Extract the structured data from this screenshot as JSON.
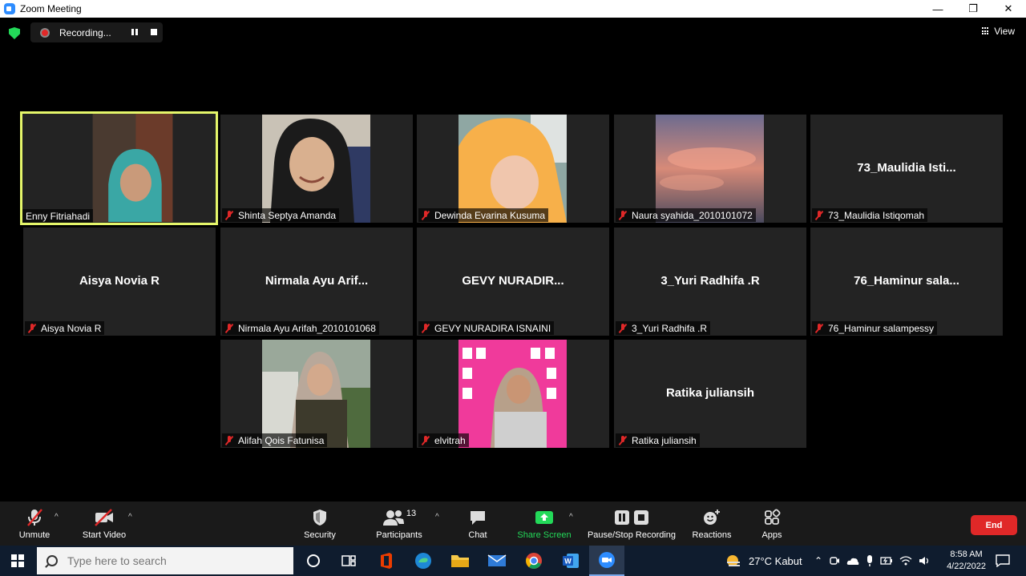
{
  "window": {
    "title": "Zoom Meeting",
    "controls": [
      "—",
      "❐",
      "✕"
    ]
  },
  "meeting": {
    "recording_label": "Recording...",
    "view_label": "View",
    "tiles": [
      {
        "label": "Enny Fitriahadi",
        "big_name": "",
        "active": true,
        "muted": false,
        "video": true
      },
      {
        "label": "Shinta Septya Amanda",
        "big_name": "",
        "muted": true,
        "video": true
      },
      {
        "label": "Dewinda Evarina Kusuma",
        "big_name": "",
        "muted": true,
        "video": true
      },
      {
        "label": "Naura syahida_2010101072",
        "big_name": "",
        "muted": true,
        "video": true
      },
      {
        "label": "73_Maulidia Istiqomah",
        "big_name": "73_Maulidia  Isti...",
        "muted": true,
        "video": false
      },
      {
        "label": "Aisya Novia R",
        "big_name": "Aisya Novia R",
        "muted": true,
        "video": false
      },
      {
        "label": "Nirmala Ayu Arifah_2010101068",
        "big_name": "Nirmala  Ayu  Arif...",
        "muted": true,
        "video": false
      },
      {
        "label": "GEVY NURADIRA ISNAINI",
        "big_name": "GEVY  NURADIR...",
        "muted": true,
        "video": false
      },
      {
        "label": "3_Yuri Radhifa .R",
        "big_name": "3_Yuri Radhifa .R",
        "muted": true,
        "video": false
      },
      {
        "label": "76_Haminur salampessy",
        "big_name": "76_Haminur  sala...",
        "muted": true,
        "video": false
      },
      {
        "label": "Alifah Qois Fatunisa",
        "big_name": "",
        "muted": true,
        "video": true
      },
      {
        "label": "elvitrah",
        "big_name": "",
        "muted": true,
        "video": true
      },
      {
        "label": "Ratika juliansih",
        "big_name": "Ratika juliansih",
        "muted": true,
        "video": false
      }
    ]
  },
  "toolbar": {
    "unmute": "Unmute",
    "start_video": "Start Video",
    "security": "Security",
    "participants": "Participants",
    "participants_count": "13",
    "chat": "Chat",
    "share_screen": "Share Screen",
    "pause_stop_recording": "Pause/Stop Recording",
    "reactions": "Reactions",
    "apps": "Apps",
    "end": "End"
  },
  "taskbar": {
    "search_placeholder": "Type here to search",
    "weather": "27°C  Kabut",
    "time": "8:58 AM",
    "date": "4/22/2022"
  },
  "colors": {
    "active_speaker_border": "#e5f66a",
    "share_green": "#23d959",
    "end_red": "#e02828"
  }
}
